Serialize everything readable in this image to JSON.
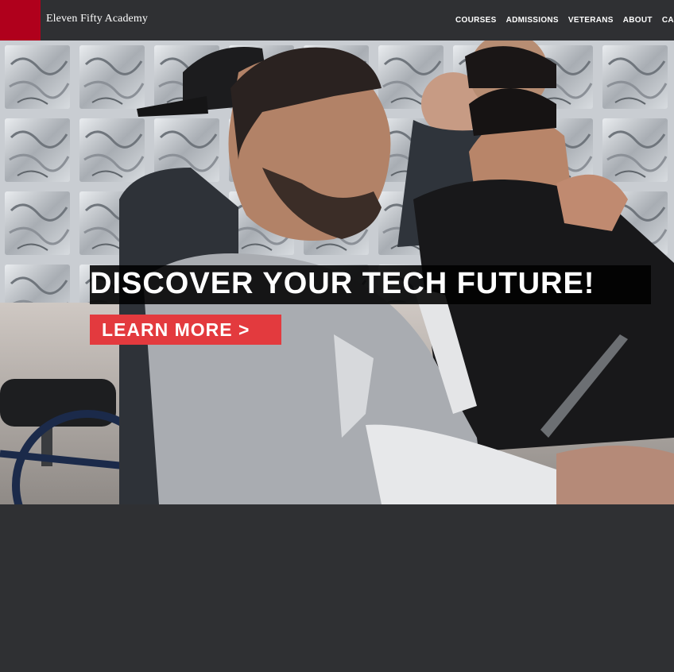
{
  "header": {
    "brand": "Eleven Fifty Academy",
    "nav": [
      "COURSES",
      "ADMISSIONS",
      "VETERANS",
      "ABOUT",
      "CAMPUS"
    ]
  },
  "hero": {
    "headline": "DISCOVER YOUR TECH FUTURE!",
    "cta_label": "LEARN MORE >",
    "image": "students-in-classroom-photo"
  },
  "colors": {
    "brand_red": "#b0001c",
    "cta_red": "#e33a3e",
    "background": "#2f3033"
  }
}
